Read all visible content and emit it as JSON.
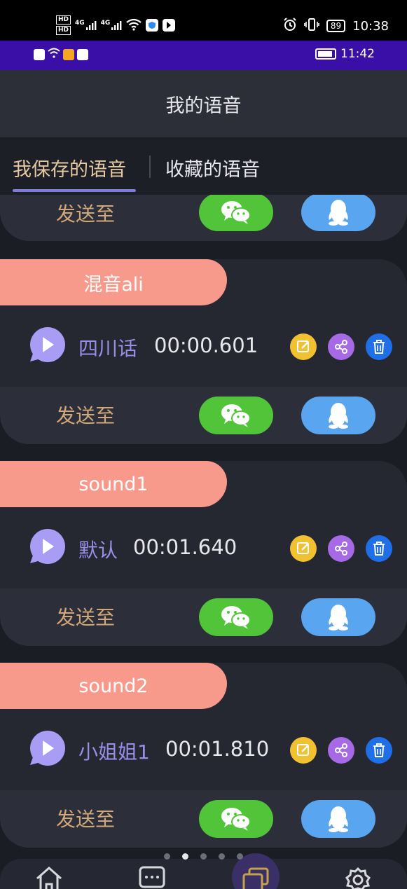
{
  "status_outer": {
    "time": "10:38",
    "battery": "89",
    "hd1": "HD",
    "hd2": "HD",
    "net1": "4G",
    "net2": "4G"
  },
  "status_inner": {
    "time": "11:42"
  },
  "header": {
    "title": "我的语音"
  },
  "tabs": [
    {
      "label": "我保存的语音",
      "active": true
    },
    {
      "label": "收藏的语音",
      "active": false
    }
  ],
  "send_label": "发送至",
  "cards": [
    {
      "tag": "混音ali",
      "voice_name": "四川话",
      "duration": "00:00.601"
    },
    {
      "tag": "sound1",
      "voice_name": "默认",
      "duration": "00:01.640"
    },
    {
      "tag": "sound2",
      "voice_name": "小姐姐1",
      "duration": "00:01.810"
    }
  ],
  "icons": {
    "play": "play-icon",
    "edit": "edit-icon",
    "share": "share-icon",
    "delete": "trash-icon",
    "wechat": "wechat-icon",
    "qq": "qq-icon"
  },
  "nav": [
    {
      "name": "home-icon"
    },
    {
      "name": "message-icon"
    },
    {
      "name": "voice-library-icon",
      "active": true
    },
    {
      "name": "settings-icon"
    }
  ],
  "pager": {
    "count": 5,
    "active_index": 1
  },
  "colors": {
    "tag": "#f7998b",
    "voice_name": "#9b8ee8",
    "send_label": "#d2a77a",
    "wechat": "#52c43a",
    "qq": "#5aa5f0",
    "edit": "#f2c132",
    "share": "#a66ae6",
    "delete": "#1f6fe8",
    "tab_active": "#e6c8a0",
    "tab_underline": "#7f7bd8"
  }
}
